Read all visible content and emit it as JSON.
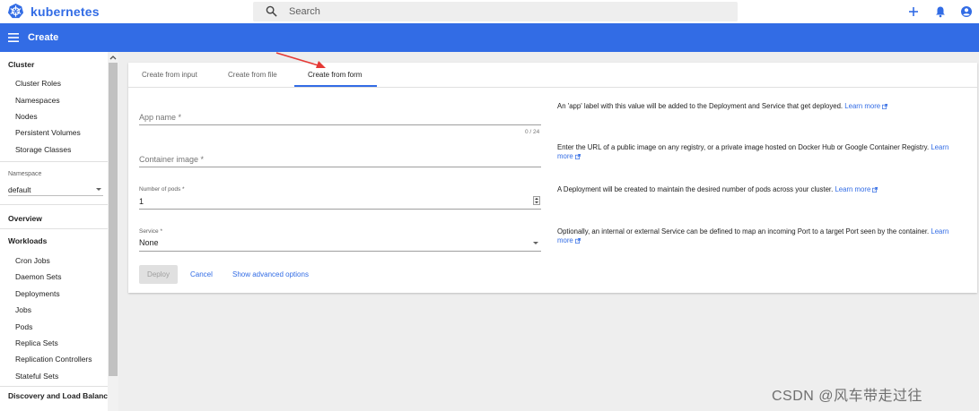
{
  "app": {
    "name": "kubernetes"
  },
  "search": {
    "placeholder": "Search"
  },
  "header": {
    "title": "Create"
  },
  "sidebar": {
    "cluster_heading": "Cluster",
    "cluster_items": [
      "Cluster Roles",
      "Namespaces",
      "Nodes",
      "Persistent Volumes",
      "Storage Classes"
    ],
    "namespace_label": "Namespace",
    "namespace_value": "default",
    "overview": "Overview",
    "workloads_heading": "Workloads",
    "workloads_items": [
      "Cron Jobs",
      "Daemon Sets",
      "Deployments",
      "Jobs",
      "Pods",
      "Replica Sets",
      "Replication Controllers",
      "Stateful Sets"
    ],
    "discovery_heading": "Discovery and Load Balancing"
  },
  "tabs": [
    {
      "label": "Create from input",
      "active": false
    },
    {
      "label": "Create from file",
      "active": false
    },
    {
      "label": "Create from form",
      "active": true
    }
  ],
  "form": {
    "app_name": {
      "label": "App name *",
      "value": "",
      "counter": "0 / 24"
    },
    "container_image": {
      "label": "Container image *",
      "value": ""
    },
    "pods": {
      "label": "Number of pods *",
      "value": "1"
    },
    "service": {
      "label": "Service *",
      "value": "None"
    }
  },
  "help": {
    "app_name": "An 'app' label with this value will be added to the Deployment and Service that get deployed.",
    "container_image": "Enter the URL of a public image on any registry, or a private image hosted on Docker Hub or Google Container Registry.",
    "pods": "A Deployment will be created to maintain the desired number of pods across your cluster.",
    "service": "Optionally, an internal or external Service can be defined to map an incoming Port to a target Port seen by the container.",
    "learn_more": "Learn more"
  },
  "actions": {
    "deploy": "Deploy",
    "cancel": "Cancel",
    "advanced": "Show advanced options"
  },
  "watermark": "CSDN @风车带走过往",
  "colors": {
    "primary": "#326ce5",
    "arrow": "#e53935"
  }
}
